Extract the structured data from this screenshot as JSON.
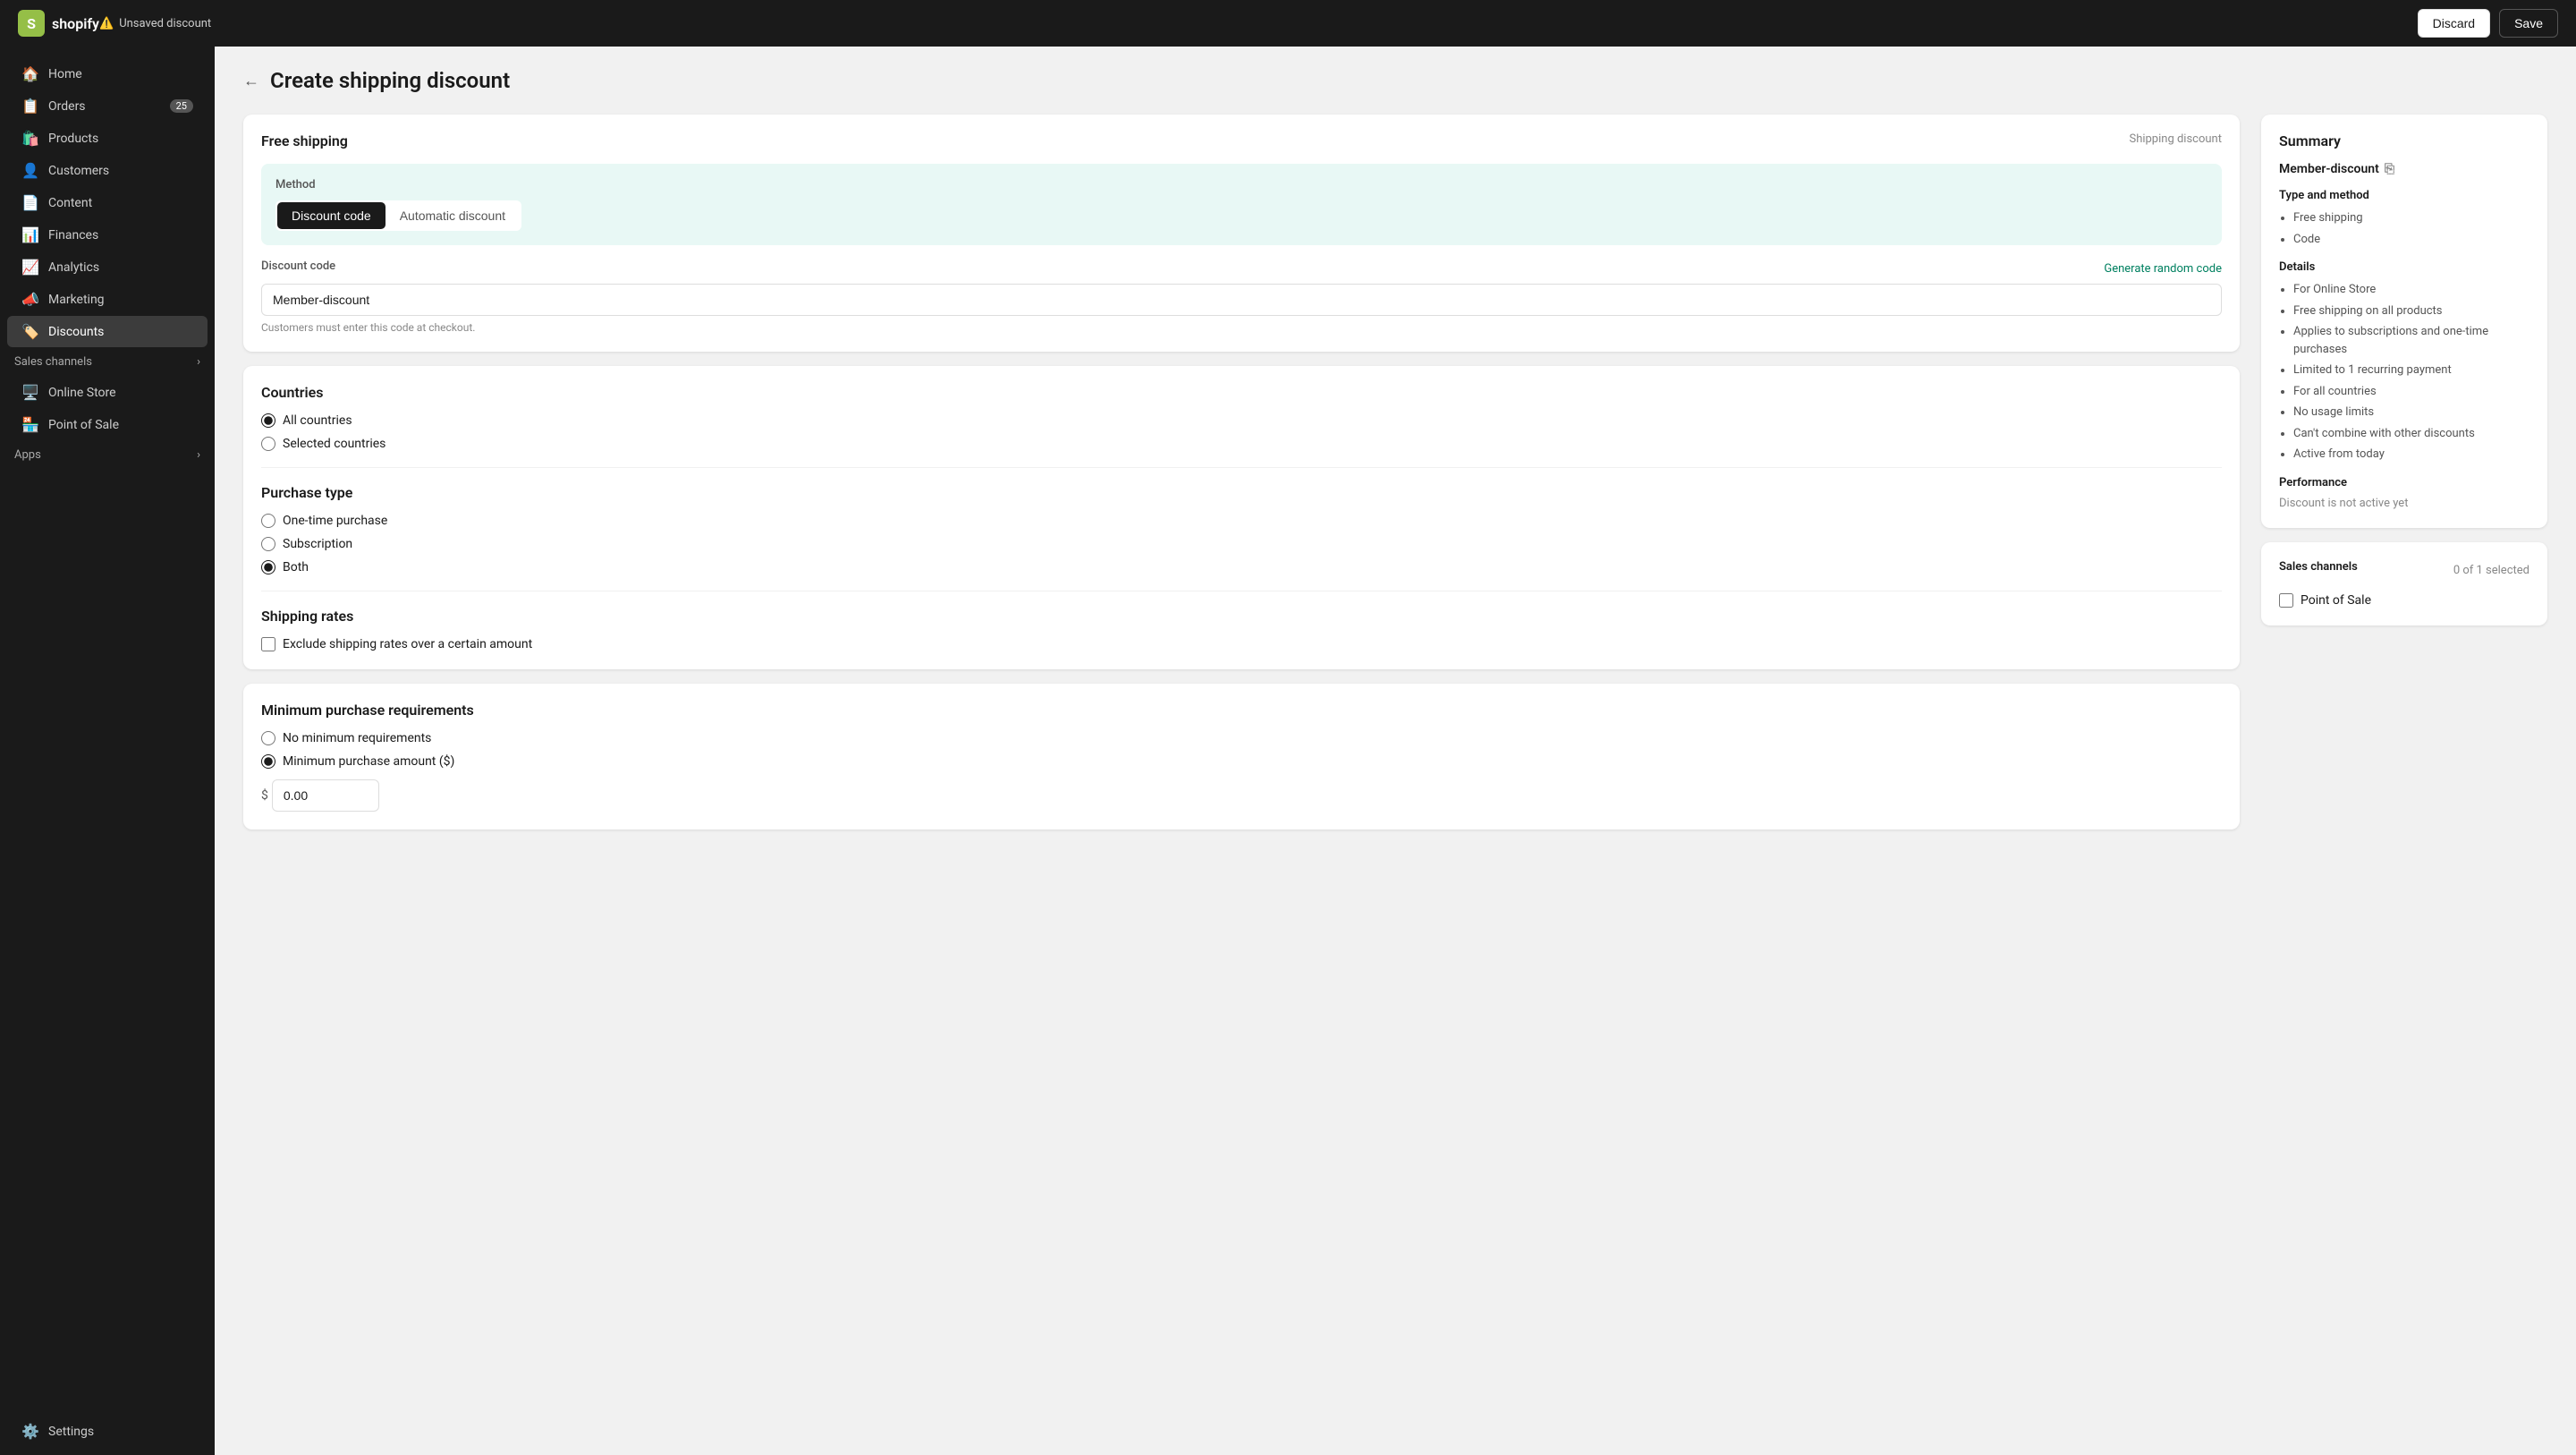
{
  "topbar": {
    "logo_text": "shopify",
    "unsaved_label": "Unsaved discount",
    "discard_label": "Discard",
    "save_label": "Save"
  },
  "sidebar": {
    "items": [
      {
        "id": "home",
        "label": "Home",
        "icon": "🏠",
        "badge": null,
        "active": false
      },
      {
        "id": "orders",
        "label": "Orders",
        "icon": "📋",
        "badge": "25",
        "active": false
      },
      {
        "id": "products",
        "label": "Products",
        "icon": "🛍️",
        "badge": null,
        "active": false
      },
      {
        "id": "customers",
        "label": "Customers",
        "icon": "👤",
        "badge": null,
        "active": false
      },
      {
        "id": "content",
        "label": "Content",
        "icon": "📄",
        "badge": null,
        "active": false
      },
      {
        "id": "finances",
        "label": "Finances",
        "icon": "📊",
        "badge": null,
        "active": false
      },
      {
        "id": "analytics",
        "label": "Analytics",
        "icon": "📈",
        "badge": null,
        "active": false
      },
      {
        "id": "marketing",
        "label": "Marketing",
        "icon": "📣",
        "badge": null,
        "active": false
      },
      {
        "id": "discounts",
        "label": "Discounts",
        "icon": "🏷️",
        "badge": null,
        "active": true
      }
    ],
    "sales_channels_label": "Sales channels",
    "sales_channel_items": [
      {
        "id": "online-store",
        "label": "Online Store",
        "icon": "🖥️"
      },
      {
        "id": "point-of-sale",
        "label": "Point of Sale",
        "icon": "🏪"
      }
    ],
    "apps_label": "Apps",
    "settings_label": "Settings"
  },
  "page": {
    "back_label": "←",
    "title": "Create shipping discount"
  },
  "main": {
    "free_shipping_card": {
      "title": "Free shipping",
      "subtitle": "Shipping discount",
      "method_label": "Method",
      "discount_code_btn": "Discount code",
      "automatic_discount_btn": "Automatic discount",
      "discount_code_label": "Discount code",
      "generate_random_label": "Generate random code",
      "discount_code_value": "Member-discount",
      "discount_code_hint": "Customers must enter this code at checkout."
    },
    "countries_card": {
      "title": "Countries",
      "all_countries_label": "All countries",
      "selected_countries_label": "Selected countries"
    },
    "purchase_type_card": {
      "title": "Purchase type",
      "one_time_label": "One-time purchase",
      "subscription_label": "Subscription",
      "both_label": "Both"
    },
    "shipping_rates_card": {
      "title": "Shipping rates",
      "exclude_label": "Exclude shipping rates over a certain amount"
    },
    "minimum_purchase_card": {
      "title": "Minimum purchase requirements",
      "no_minimum_label": "No minimum requirements",
      "minimum_amount_label": "Minimum purchase amount ($)"
    }
  },
  "summary": {
    "title": "Summary",
    "name": "Member-discount",
    "type_method_title": "Type and method",
    "type_items": [
      "Free shipping",
      "Code"
    ],
    "details_title": "Details",
    "details_items": [
      "For Online Store",
      "Free shipping on all products",
      "Applies to subscriptions and one-time purchases",
      "Limited to 1 recurring payment",
      "For all countries",
      "No usage limits",
      "Can't combine with other discounts",
      "Active from today"
    ],
    "performance_title": "Performance",
    "performance_text": "Discount is not active yet",
    "sales_channels_title": "Sales channels",
    "sales_channels_count": "0 of 1 selected",
    "point_of_sale_label": "Point of Sale"
  }
}
